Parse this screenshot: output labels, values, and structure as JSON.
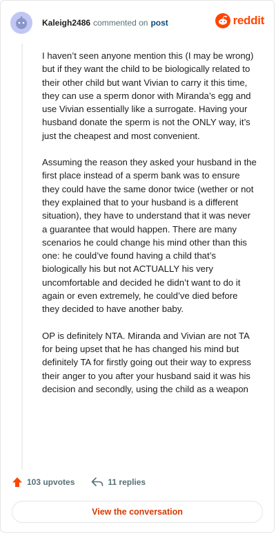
{
  "header": {
    "username": "Kaleigh2486",
    "action_text": "commented on",
    "target_text": "post",
    "logo_text": "reddit"
  },
  "comment": {
    "paragraphs": [
      "I haven’t seen anyone mention this (I may be wrong) but if they want the child to be biologically related to their other child but want Vivian to carry it this time, they can use a sperm donor with Miranda’s egg and use Vivian essentially like a surrogate. Having your husband donate the sperm is not the ONLY way, it’s just the cheapest and most convenient.",
      "Assuming the reason they asked your husband in the first place instead of a sperm bank was to ensure they could have the same donor twice (wether or not they explained that to your husband is a different situation), they have to understand that it was never a guarantee that would happen. There are many scenarios he could change his mind other than this one: he could’ve found having a child that’s biologically his but not ACTUALLY his very uncomfortable and decided he didn’t want to do it again or even extremely, he could’ve died before they decided to have another baby.",
      "OP is definitely NTA. Miranda and Vivian are not TA for being upset that he has changed his mind but definitely TA for firstly going out their way to express their anger to you after your husband said it was his decision and secondly, using the child as a weapon"
    ]
  },
  "actions": {
    "upvotes_label": "103 upvotes",
    "replies_label": "11 replies"
  },
  "cta": {
    "label": "View the conversation"
  },
  "colors": {
    "brand": "#ff4500",
    "cta_text": "#d93900",
    "avatar_bg": "#c1c7f3"
  },
  "icons": {
    "avatar": "snoo-avatar-icon",
    "logo": "reddit-alien-icon",
    "upvote": "upvote-arrow-icon",
    "reply": "reply-arrow-icon"
  }
}
